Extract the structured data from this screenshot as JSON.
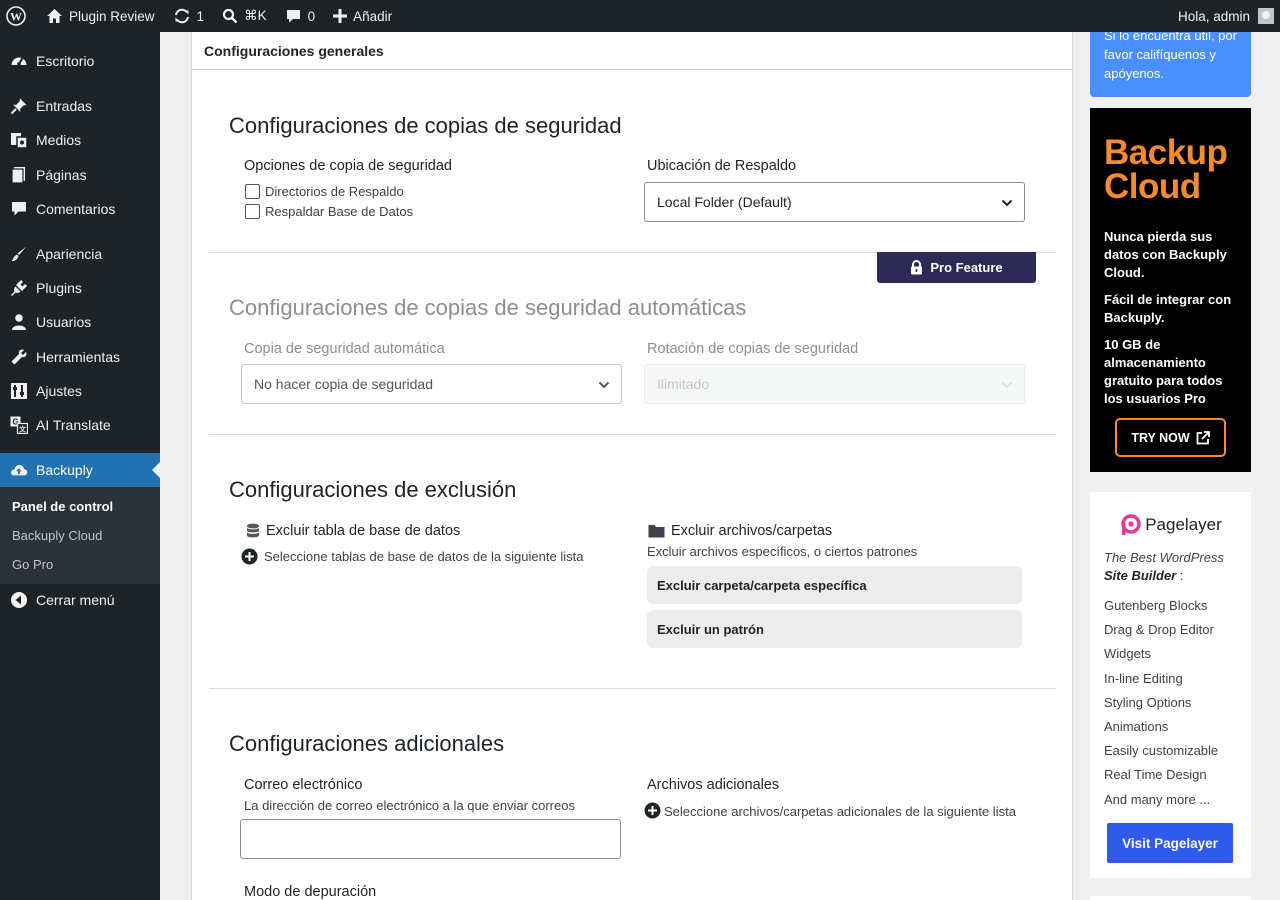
{
  "adminbar": {
    "site_name": "Plugin Review",
    "updates_count": "1",
    "search_shortcut": "⌘K",
    "comments_count": "0",
    "add_new": "Añadir",
    "greeting": "Hola, admin"
  },
  "sidebar": {
    "items": [
      {
        "label": "Escritorio",
        "icon": "dashboard-icon"
      },
      {
        "label": "Entradas",
        "icon": "pin-icon"
      },
      {
        "label": "Medios",
        "icon": "media-icon"
      },
      {
        "label": "Páginas",
        "icon": "page-icon"
      },
      {
        "label": "Comentarios",
        "icon": "comment-icon"
      },
      {
        "label": "Apariencia",
        "icon": "brush-icon"
      },
      {
        "label": "Plugins",
        "icon": "plugin-icon"
      },
      {
        "label": "Usuarios",
        "icon": "user-icon"
      },
      {
        "label": "Herramientas",
        "icon": "wrench-icon"
      },
      {
        "label": "Ajustes",
        "icon": "settings-icon"
      },
      {
        "label": "AI Translate",
        "icon": "translate-icon"
      },
      {
        "label": "Backuply",
        "icon": "cloud-upload-icon"
      }
    ],
    "submenu": [
      "Panel de control",
      "Backuply Cloud",
      "Go Pro"
    ],
    "collapse": "Cerrar menú"
  },
  "main": {
    "header": "Configuraciones generales",
    "backup": {
      "title": "Configuraciones de copias de seguridad",
      "options_label": "Opciones de copia de seguridad",
      "check_dirs": "Directorios de Respaldo",
      "check_db": "Respaldar Base de Datos",
      "location_label": "Ubicación de Respaldo",
      "location_value": "Local Folder (Default)"
    },
    "auto": {
      "pro_badge": "Pro Feature",
      "title": "Configuraciones de copias de seguridad automáticas",
      "auto_label": "Copia de seguridad automática",
      "auto_value": "No hacer copia de seguridad",
      "rotation_label": "Rotación de copias de seguridad",
      "rotation_value": "Ilimitado"
    },
    "exclusion": {
      "title": "Configuraciones de exclusión",
      "db_label": "Excluir tabla de base de datos",
      "db_select": "Seleccione tablas de base de datos de la siguiente lista",
      "files_label": "Excluir archivos/carpetas",
      "files_desc": "Excluir archivos específicos, o ciertos patrones",
      "btn_folder": "Excluir carpeta/carpeta específica",
      "btn_pattern": "Excluir un patrón"
    },
    "additional": {
      "title": "Configuraciones adicionales",
      "email_label": "Correo electrónico",
      "email_desc": "La dirección de correo electrónico a la que enviar correos",
      "email_value": "",
      "files_label": "Archivos adicionales",
      "files_select": "Seleccione archivos/carpetas adicionales de la siguiente lista",
      "debug_label": "Modo de depuración"
    }
  },
  "right": {
    "promo_text": "Si lo encuentra útil, por favor califíquenos y apóyenos.",
    "backup_cloud": {
      "title_line1": "Backup",
      "title_line2": "Cloud",
      "p1": "Nunca pierda sus datos con Backuply Cloud.",
      "p2": "Fácil de integrar con Backuply.",
      "p3": "10 GB de almacenamiento gratuito para todos los usuarios Pro",
      "button": "TRY NOW"
    },
    "pagelayer": {
      "name": "Pagelayer",
      "tagline_1": "The Best WordPress",
      "tagline_2": "Site Builder",
      "tagline_suffix": " :",
      "features": [
        "Gutenberg Blocks",
        "Drag & Drop Editor",
        "Widgets",
        "In-line Editing",
        "Styling Options",
        "Animations",
        "Easily customizable",
        "Real Time Design",
        "And many more ..."
      ],
      "button": "Visit Pagelayer"
    }
  },
  "colors": {
    "admin_dark": "#1d2327",
    "wp_blue": "#2271b1",
    "backup_orange": "#f58b2c",
    "pro_purple": "#2e2a57",
    "pagelayer_pink": "#e43996",
    "pagelayer_blue": "#2f5aeb"
  }
}
